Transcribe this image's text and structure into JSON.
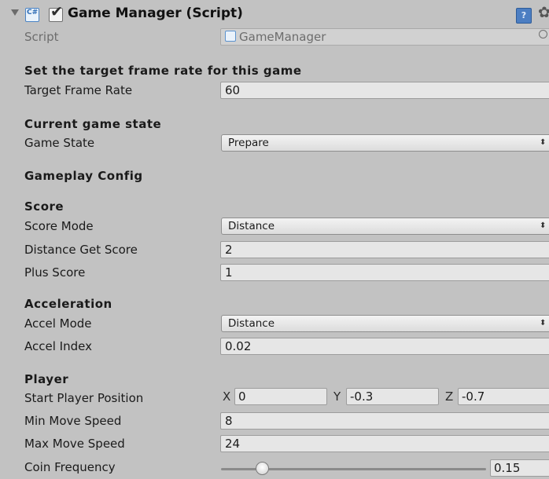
{
  "header": {
    "title": "Game Manager (Script)",
    "enabled": true
  },
  "script": {
    "label": "Script",
    "value": "GameManager"
  },
  "sections": {
    "frame_rate_header": "Set the target frame rate for this game",
    "state_header": "Current game state",
    "gameplay_header": "Gameplay Config",
    "score_header": "Score",
    "accel_header": "Acceleration",
    "player_header": "Player"
  },
  "fields": {
    "target_frame_rate": {
      "label": "Target Frame Rate",
      "value": "60"
    },
    "game_state": {
      "label": "Game State",
      "value": "Prepare"
    },
    "score_mode": {
      "label": "Score Mode",
      "value": "Distance"
    },
    "distance_get_score": {
      "label": "Distance Get Score",
      "value": "2"
    },
    "plus_score": {
      "label": "Plus Score",
      "value": "1"
    },
    "accel_mode": {
      "label": "Accel Mode",
      "value": "Distance"
    },
    "accel_index": {
      "label": "Accel Index",
      "value": "0.02"
    },
    "start_player_position": {
      "label": "Start Player Position",
      "x_label": "X",
      "x": "0",
      "y_label": "Y",
      "y": "-0.3",
      "z_label": "Z",
      "z": "-0.7"
    },
    "min_move_speed": {
      "label": "Min Move Speed",
      "value": "8"
    },
    "max_move_speed": {
      "label": "Max Move Speed",
      "value": "24"
    },
    "coin_frequency": {
      "label": "Coin Frequency",
      "value": "0.15",
      "slider_fraction": 0.15
    }
  },
  "icons": {
    "foldout": "triangle-down-icon",
    "script": "csharp-script-icon",
    "help": "help-book-icon",
    "settings": "gear-icon",
    "object_picker": "object-picker-icon"
  },
  "colors": {
    "background": "#c2c2c2",
    "field": "#e6e6e6",
    "accent": "#4c7ec2"
  }
}
